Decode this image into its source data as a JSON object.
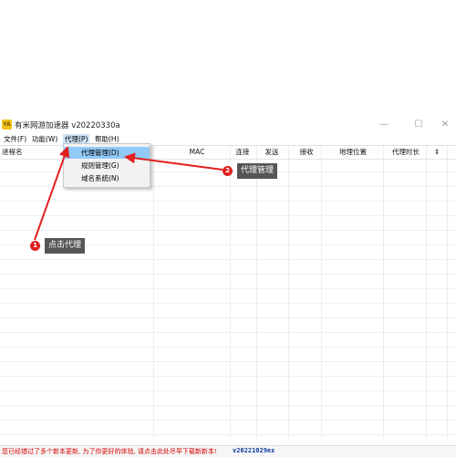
{
  "window": {
    "title": "有米网游加速器 v20220330a",
    "icon_label": "YA",
    "buttons": {
      "minimize": "—",
      "maximize": "☐",
      "close": "✕"
    }
  },
  "menubar": {
    "items": [
      "文件(F)",
      "功能(W)",
      "代理(P)",
      "帮助(H)"
    ]
  },
  "table": {
    "columns": [
      "进程名",
      "MAC",
      "连接",
      "发送",
      "接收",
      "地理位置",
      "代理时长",
      "⇕"
    ]
  },
  "proxy_menu": {
    "items": [
      "代理管理(D)",
      "规则管理(G)",
      "域名系统(N)"
    ]
  },
  "annotations": [
    {
      "number": "1",
      "label": "点击代理"
    },
    {
      "number": "2",
      "label": "代理管理"
    }
  ],
  "annotation_color": "#e02020",
  "status": {
    "message": "您已经错过了多个新本更新, 为了你更好的体验, 请点击此处尽早下载新新本!",
    "version": "v20221029ex"
  }
}
